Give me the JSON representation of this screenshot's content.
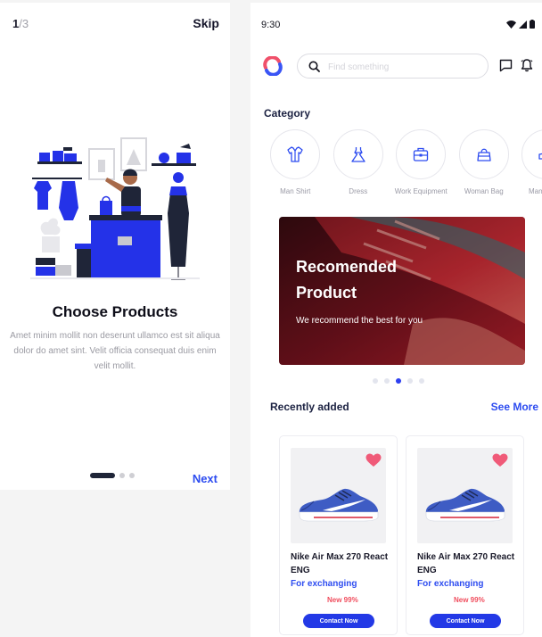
{
  "onboarding": {
    "page_current": "1",
    "page_total": "/3",
    "skip_label": "Skip",
    "title": "Choose Products",
    "description": "Amet minim mollit non deserunt ullamco est sit aliqua dolor do amet sint. Velit officia consequat duis enim velit mollit.",
    "next_label": "Next",
    "active_dot": 0
  },
  "home": {
    "status_time": "9:30",
    "search": {
      "placeholder": "Find something"
    },
    "category": {
      "title": "Category",
      "items": [
        {
          "label": "Man Shirt",
          "icon": "shirt-icon"
        },
        {
          "label": "Dress",
          "icon": "dress-icon"
        },
        {
          "label": "Work Equipment",
          "icon": "briefcase-icon"
        },
        {
          "label": "Woman Bag",
          "icon": "handbag-icon"
        },
        {
          "label": "Man Shoes",
          "icon": "shoe-icon"
        }
      ]
    },
    "banner": {
      "title": "Recomended Product",
      "subtitle": "We recommend the best for you",
      "active_dot": 2,
      "dot_count": 5
    },
    "recent": {
      "title": "Recently added",
      "see_more": "See More",
      "products": [
        {
          "name": "Nike Air Max 270 React ENG",
          "status": "For exchanging",
          "badge": "New 99%",
          "button": "Contact Now"
        },
        {
          "name": "Nike Air Max 270 React ENG",
          "status": "For exchanging",
          "badge": "New 99%",
          "button": "Contact Now"
        }
      ]
    },
    "colors": {
      "accent": "#2D4CF0",
      "badge": "#F04E5E",
      "heart": "#F05A78",
      "dark": "#1C2242"
    }
  }
}
